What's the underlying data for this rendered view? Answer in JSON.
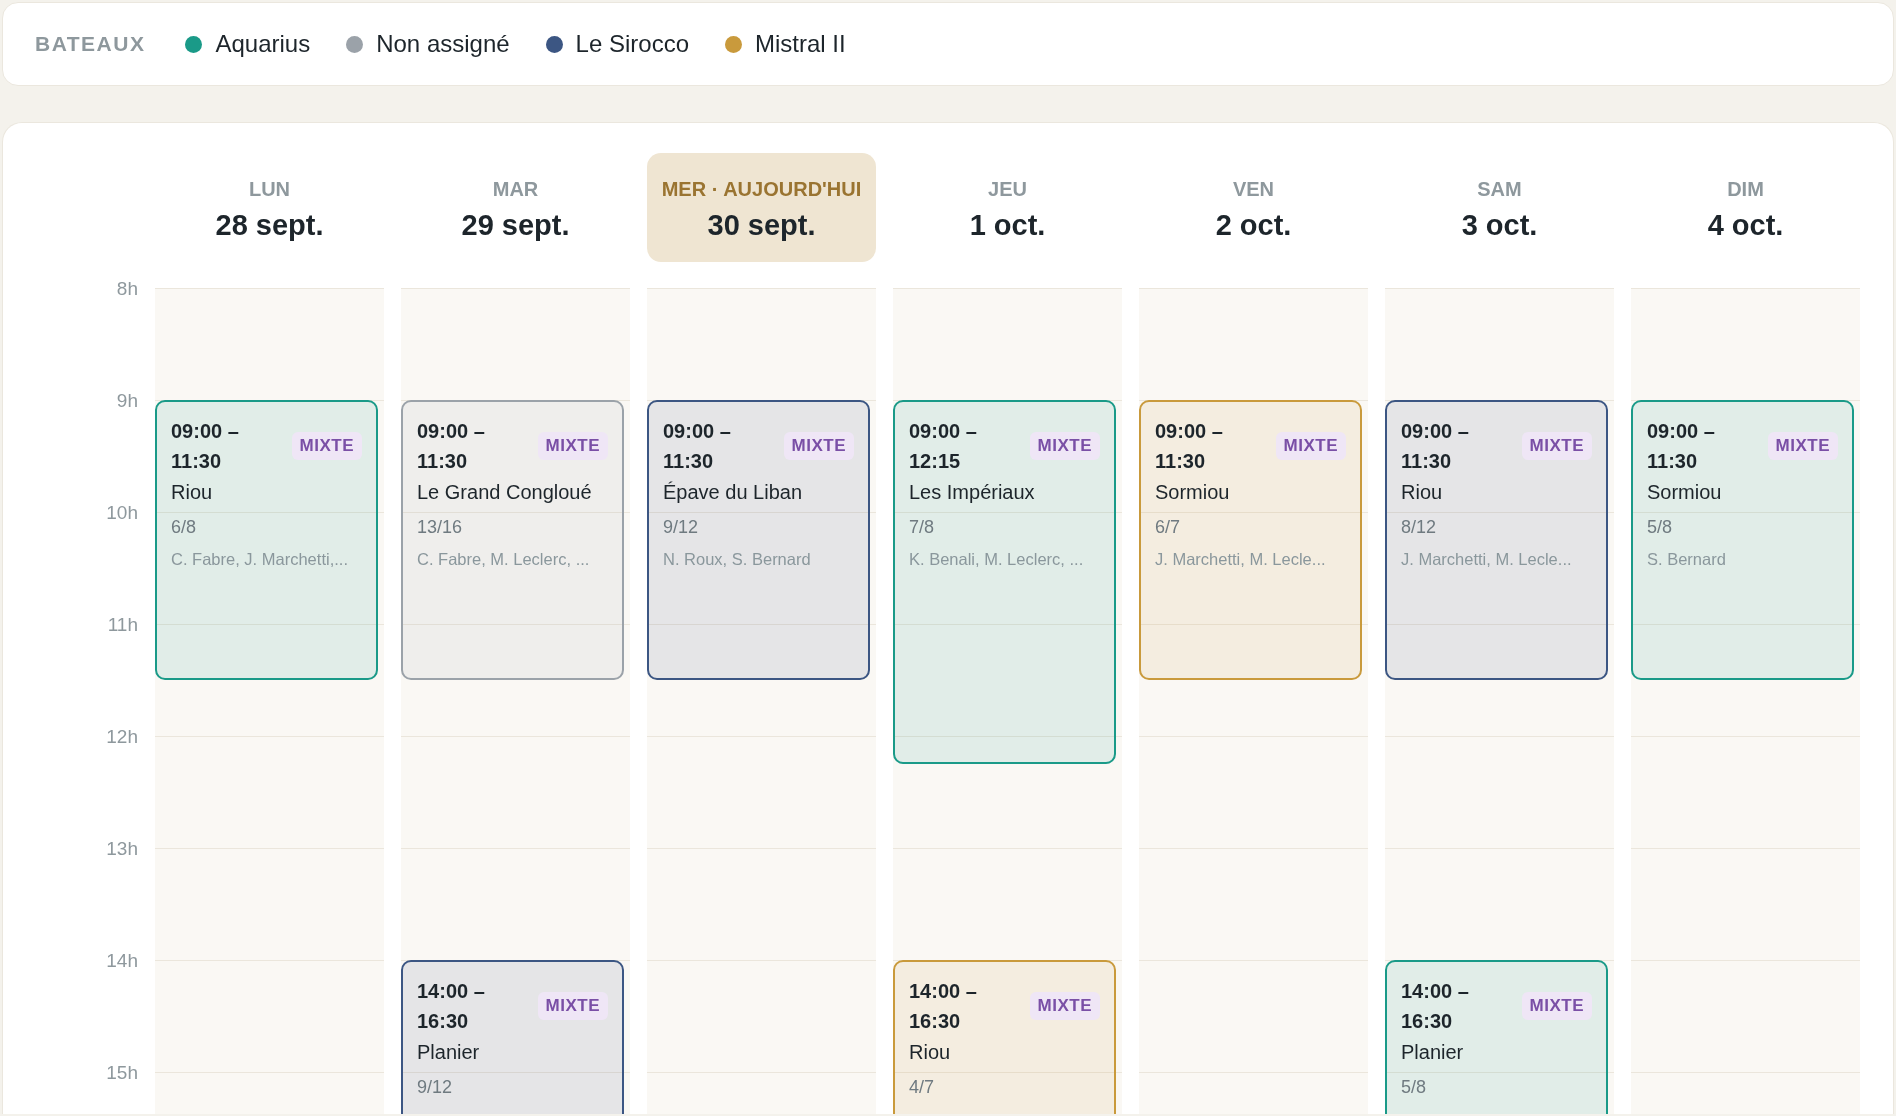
{
  "legend": {
    "title": "BATEAUX",
    "boats": [
      {
        "name": "Aquarius",
        "color": "#1a9a88"
      },
      {
        "name": "Non assigné",
        "color": "#9ba2a9"
      },
      {
        "name": "Le Sirocco",
        "color": "#3c5683"
      },
      {
        "name": "Mistral II",
        "color": "#c99a3c"
      }
    ]
  },
  "hours": [
    "8h",
    "9h",
    "10h",
    "11h",
    "12h",
    "13h",
    "14h",
    "15h"
  ],
  "days": [
    {
      "weekday": "LUN",
      "date": "28 sept.",
      "today": false,
      "events": [
        {
          "time": "09:00 – 11:30",
          "tag": "MIXTE",
          "site": "Riou",
          "count": "6/8",
          "crew": "C. Fabre, J. Marchetti,...",
          "color": "#1a9a88"
        }
      ]
    },
    {
      "weekday": "MAR",
      "date": "29 sept.",
      "today": false,
      "events": [
        {
          "time": "09:00 – 11:30",
          "tag": "MIXTE",
          "site": "Le Grand Congloué",
          "count": "13/16",
          "crew": "C. Fabre, M. Leclerc, ...",
          "color": "#9ba2a9"
        },
        {
          "time": "14:00 – 16:30",
          "tag": "MIXTE",
          "site": "Planier",
          "count": "9/12",
          "color": "#3c5683"
        }
      ]
    },
    {
      "weekday": "MER · AUJOURD'HUI",
      "date": "30 sept.",
      "today": true,
      "events": [
        {
          "time": "09:00 – 11:30",
          "tag": "MIXTE",
          "site": "Épave du Liban",
          "count": "9/12",
          "crew": "N. Roux, S. Bernard",
          "color": "#3c5683"
        }
      ]
    },
    {
      "weekday": "JEU",
      "date": "1 oct.",
      "today": false,
      "events": [
        {
          "time": "09:00 – 12:15",
          "tag": "MIXTE",
          "site": "Les Impériaux",
          "count": "7/8",
          "crew": "K. Benali, M. Leclerc, ...",
          "color": "#1a9a88"
        },
        {
          "time": "14:00 – 16:30",
          "tag": "MIXTE",
          "site": "Riou",
          "count": "4/7",
          "color": "#c99a3c"
        }
      ]
    },
    {
      "weekday": "VEN",
      "date": "2 oct.",
      "today": false,
      "events": [
        {
          "time": "09:00 – 11:30",
          "tag": "MIXTE",
          "site": "Sormiou",
          "count": "6/7",
          "crew": "J. Marchetti, M. Lecle...",
          "color": "#c99a3c"
        }
      ]
    },
    {
      "weekday": "SAM",
      "date": "3 oct.",
      "today": false,
      "events": [
        {
          "time": "09:00 – 11:30",
          "tag": "MIXTE",
          "site": "Riou",
          "count": "8/12",
          "crew": "J. Marchetti, M. Lecle...",
          "color": "#3c5683"
        },
        {
          "time": "14:00 – 16:30",
          "tag": "MIXTE",
          "site": "Planier",
          "count": "5/8",
          "color": "#1a9a88"
        }
      ]
    },
    {
      "weekday": "DIM",
      "date": "4 oct.",
      "today": false,
      "events": [
        {
          "time": "09:00 – 11:30",
          "tag": "MIXTE",
          "site": "Sormiou",
          "count": "5/8",
          "crew": "S. Bernard",
          "color": "#1a9a88"
        }
      ]
    }
  ]
}
